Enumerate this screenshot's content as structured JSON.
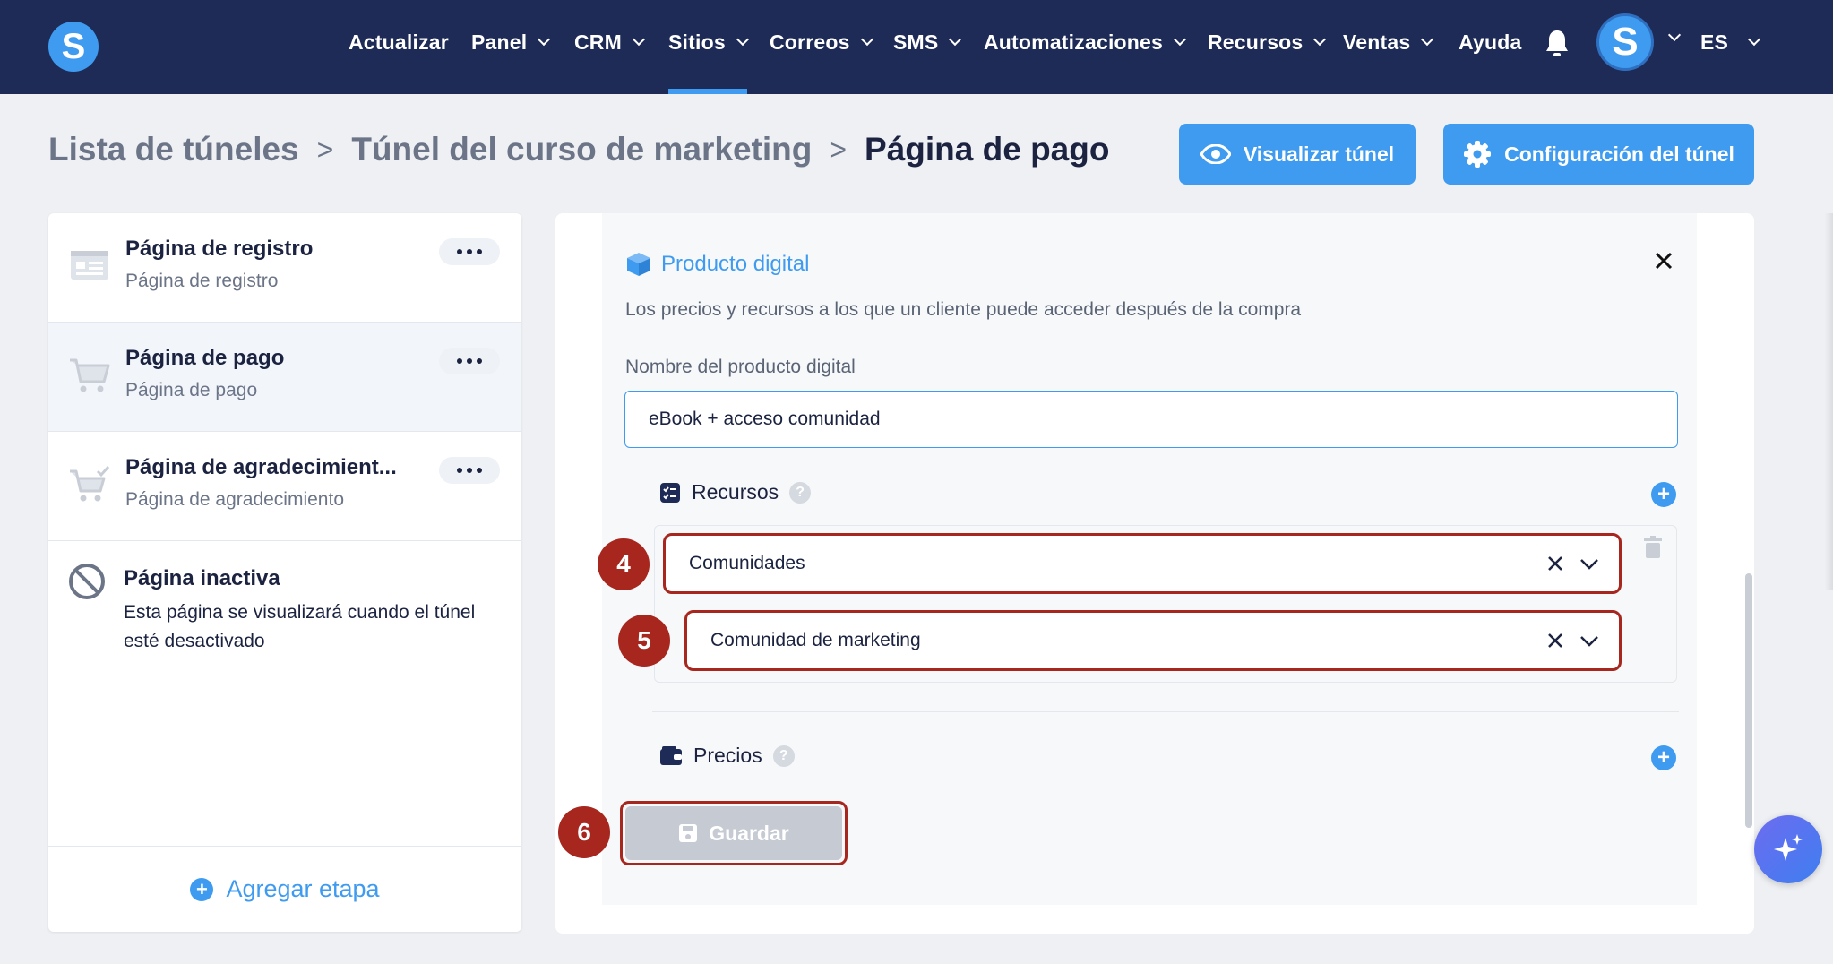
{
  "brand": {
    "logo_letter": "S"
  },
  "nav": {
    "items": [
      {
        "label": "Actualizar",
        "dropdown": false
      },
      {
        "label": "Panel",
        "dropdown": true
      },
      {
        "label": "CRM",
        "dropdown": true
      },
      {
        "label": "Sitios",
        "dropdown": true,
        "active": true
      },
      {
        "label": "Correos",
        "dropdown": true
      },
      {
        "label": "SMS",
        "dropdown": true
      },
      {
        "label": "Automatizaciones",
        "dropdown": true
      },
      {
        "label": "Recursos",
        "dropdown": true
      },
      {
        "label": "Ventas",
        "dropdown": true
      },
      {
        "label": "Ayuda",
        "dropdown": false
      }
    ],
    "avatar_letter": "S",
    "language": "ES"
  },
  "breadcrumb": {
    "items": [
      "Lista de túneles",
      "Túnel del curso de marketing",
      "Página de pago"
    ],
    "separator": ">"
  },
  "header_buttons": {
    "preview": "Visualizar túnel",
    "settings": "Configuración del túnel"
  },
  "steps": [
    {
      "title": "Página de registro",
      "subtitle": "Página de registro",
      "icon": "form-page-icon"
    },
    {
      "title": "Página de pago",
      "subtitle": "Página de pago",
      "icon": "cart-icon",
      "active": true
    },
    {
      "title": "Página de agradecimient...",
      "subtitle": "Página de agradecimiento",
      "icon": "cart-check-icon"
    }
  ],
  "inactive_page": {
    "title": "Página inactiva",
    "description": "Esta página se visualizará cuando el túnel esté desactivado"
  },
  "add_step_label": "Agregar etapa",
  "product": {
    "section_title": "Producto digital",
    "description": "Los precios y recursos a los que un cliente puede acceder después de la compra",
    "name_label": "Nombre del producto digital",
    "name_value": "eBook + acceso comunidad",
    "resources_label": "Recursos",
    "resource_type": "Comunidades",
    "resource_value": "Comunidad de marketing",
    "prices_label": "Precios",
    "help_glyph": "?",
    "save_label": "Guardar"
  },
  "annotations": [
    "4",
    "5",
    "6"
  ],
  "colors": {
    "nav_bg": "#1e2b57",
    "accent": "#3e9bf0",
    "highlight": "#a7261e",
    "disabled": "#c5cad3"
  }
}
